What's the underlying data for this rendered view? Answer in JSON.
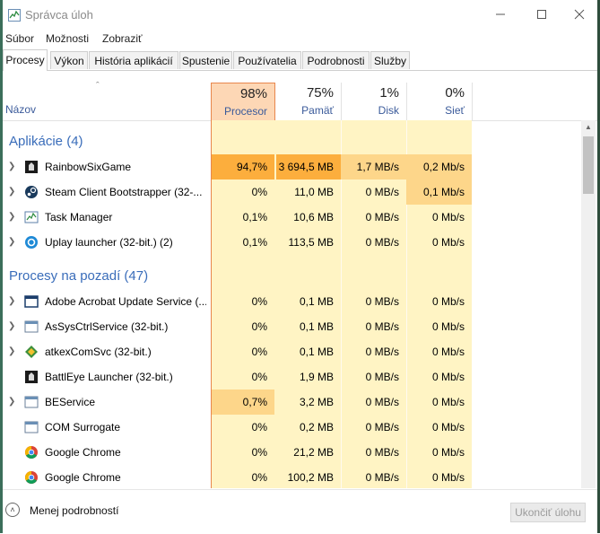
{
  "window": {
    "title": "Správca úloh"
  },
  "menu": [
    "Súbor",
    "Možnosti",
    "Zobraziť"
  ],
  "tabs": [
    "Procesy",
    "Výkon",
    "História aplikácií",
    "Spustenie",
    "Používatelia",
    "Podrobnosti",
    "Služby"
  ],
  "header": {
    "name": "Názov",
    "cpu_pct": "98%",
    "cpu_label": "Procesor",
    "mem_pct": "75%",
    "mem_label": "Pamäť",
    "disk_pct": "1%",
    "disk_label": "Disk",
    "net_pct": "0%",
    "net_label": "Sieť"
  },
  "groups": {
    "apps": "Aplikácie (4)",
    "background": "Procesy na pozadí (47)"
  },
  "apps": [
    {
      "name": "RainbowSixGame",
      "cpu": "94,7%",
      "mem": "3 694,5 MB",
      "disk": "1,7 MB/s",
      "net": "0,2 Mb/s",
      "icon": "r6-icon"
    },
    {
      "name": "Steam Client Bootstrapper (32-...",
      "cpu": "0%",
      "mem": "11,0 MB",
      "disk": "0 MB/s",
      "net": "0,1 Mb/s",
      "icon": "steam-icon"
    },
    {
      "name": "Task Manager",
      "cpu": "0,1%",
      "mem": "10,6 MB",
      "disk": "0 MB/s",
      "net": "0 Mb/s",
      "icon": "task-manager-icon"
    },
    {
      "name": "Uplay launcher (32-bit.) (2)",
      "cpu": "0,1%",
      "mem": "113,5 MB",
      "disk": "0 MB/s",
      "net": "0 Mb/s",
      "icon": "uplay-icon"
    }
  ],
  "background": [
    {
      "name": "Adobe Acrobat Update Service (...",
      "cpu": "0%",
      "mem": "0,1 MB",
      "disk": "0 MB/s",
      "net": "0 Mb/s",
      "icon": "service-window-icon"
    },
    {
      "name": "AsSysCtrlService (32-bit.)",
      "cpu": "0%",
      "mem": "0,1 MB",
      "disk": "0 MB/s",
      "net": "0 Mb/s",
      "icon": "service-window-icon"
    },
    {
      "name": "atkexComSvc (32-bit.)",
      "cpu": "0%",
      "mem": "0,1 MB",
      "disk": "0 MB/s",
      "net": "0 Mb/s",
      "icon": "atk-icon"
    },
    {
      "name": "BattlEye Launcher (32-bit.)",
      "cpu": "0%",
      "mem": "1,9 MB",
      "disk": "0 MB/s",
      "net": "0 Mb/s",
      "icon": "battleye-icon"
    },
    {
      "name": "BEService",
      "cpu": "0,7%",
      "mem": "3,2 MB",
      "disk": "0 MB/s",
      "net": "0 Mb/s",
      "icon": "service-window-icon"
    },
    {
      "name": "COM Surrogate",
      "cpu": "0%",
      "mem": "0,2 MB",
      "disk": "0 MB/s",
      "net": "0 Mb/s",
      "icon": "service-window-icon"
    },
    {
      "name": "Google Chrome",
      "cpu": "0%",
      "mem": "21,2 MB",
      "disk": "0 MB/s",
      "net": "0 Mb/s",
      "icon": "chrome-icon"
    },
    {
      "name": "Google Chrome",
      "cpu": "0%",
      "mem": "100,2 MB",
      "disk": "0 MB/s",
      "net": "0 Mb/s",
      "icon": "chrome-icon"
    }
  ],
  "footer": {
    "less_details": "Menej podrobností",
    "end_task": "Ukončiť úlohu"
  },
  "colors": {
    "cpu_header": "#fdd7b5",
    "cpu_border": "#e8874d",
    "hot_cell": "#fcae3d",
    "warm_cell": "#fdd68a",
    "column_bg": "#fff4c4",
    "group_title": "#3a6dba"
  }
}
